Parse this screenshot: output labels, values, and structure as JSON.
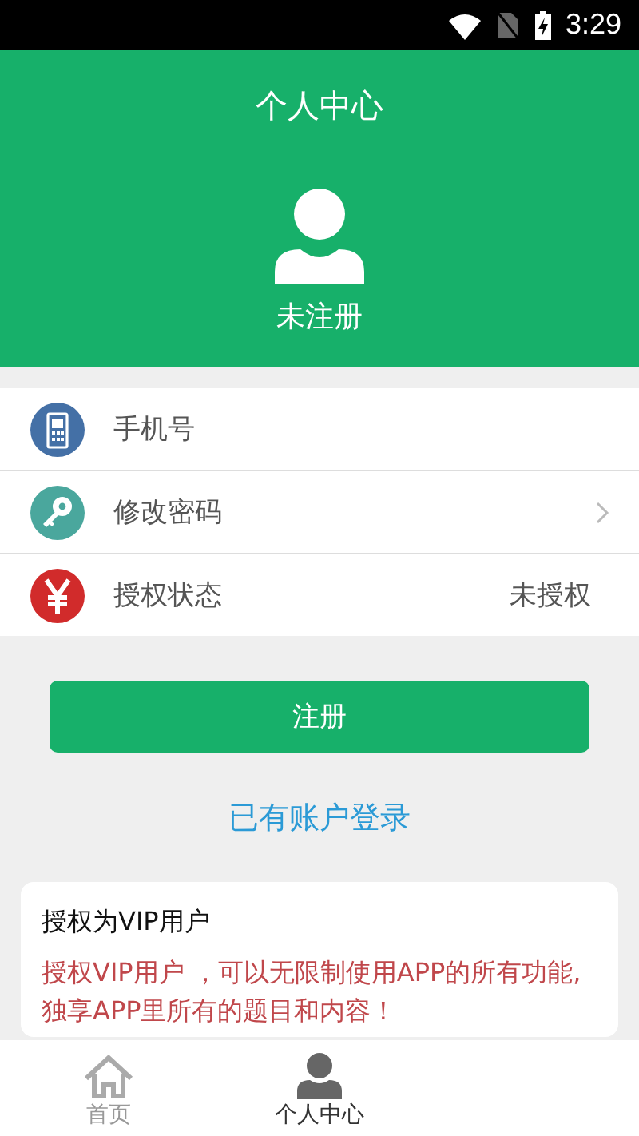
{
  "status_bar": {
    "time": "3:29"
  },
  "header": {
    "title": "个人中心",
    "user_name": "未注册"
  },
  "menu_items": [
    {
      "kind": "phone",
      "label": "手机号",
      "chevron": false
    },
    {
      "kind": "key",
      "label": "修改密码",
      "chevron": true
    },
    {
      "kind": "yen",
      "label": "授权状态",
      "value": "未授权",
      "chevron": false
    }
  ],
  "register_button": "注册",
  "login_link": "已有账户登录",
  "vip_card": {
    "title": "授权为VIP用户",
    "text": "授权VIP用户 ，可以无限制使用APP的所有功能, 独享APP里所有的题目和内容！"
  },
  "bottom_nav": [
    {
      "kind": "home",
      "label": "首页",
      "selected": false
    },
    {
      "kind": "person",
      "label": "个人中心",
      "selected": true
    }
  ]
}
